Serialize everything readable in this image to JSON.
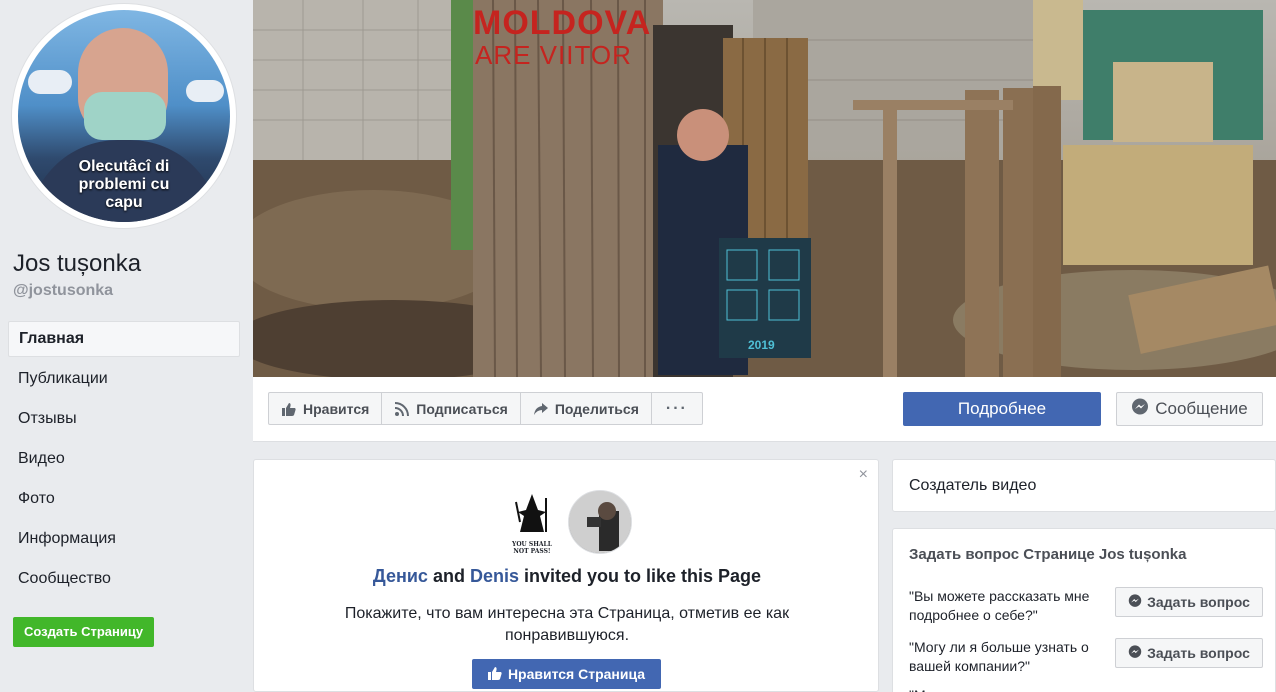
{
  "profile": {
    "avatar_caption": "Olecutâcî di problemi cu capu",
    "name": "Jos tușonka",
    "handle": "@jostusonka"
  },
  "nav": [
    {
      "label": "Главная",
      "active": true
    },
    {
      "label": "Публикации"
    },
    {
      "label": "Отзывы"
    },
    {
      "label": "Видео"
    },
    {
      "label": "Фото"
    },
    {
      "label": "Информация"
    },
    {
      "label": "Сообщество"
    }
  ],
  "create_page": "Создать Страницу",
  "cover": {
    "title": "MOLDOVA",
    "subtitle": "ARE VIITOR",
    "calendar_year": "2019"
  },
  "actions": {
    "like": "Нравится",
    "follow": "Подписаться",
    "share": "Поделиться",
    "more": "···",
    "learn_more": "Подробнее",
    "message": "Сообщение"
  },
  "invite": {
    "close": "×",
    "friend1": "Денис",
    "and": "and",
    "friend2": "Denis",
    "invited_text": "invited you to like this Page",
    "body": "Покажите, что вам интересна эта Страница, отметив ее как понравившуюся.",
    "wizard_caption": "YOU SHALL NOT PASS!",
    "like_page_button": "Нравится Страница"
  },
  "right": {
    "video_creator": "Создатель видео",
    "ask_title": "Задать вопрос Странице Jos tușonka",
    "questions": [
      {
        "text": "\"Вы можете рассказать мне подробнее о себе?\"",
        "button": "Задать вопрос"
      },
      {
        "text": "\"Могу ли я больше узнать о вашей компании?\"",
        "button": "Задать вопрос"
      },
      {
        "text": "\"М",
        "button": ""
      }
    ]
  },
  "colors": {
    "brand_blue": "#4267b2",
    "link_blue": "#365899",
    "green": "#42b72a",
    "cover_red": "#c5241f"
  }
}
